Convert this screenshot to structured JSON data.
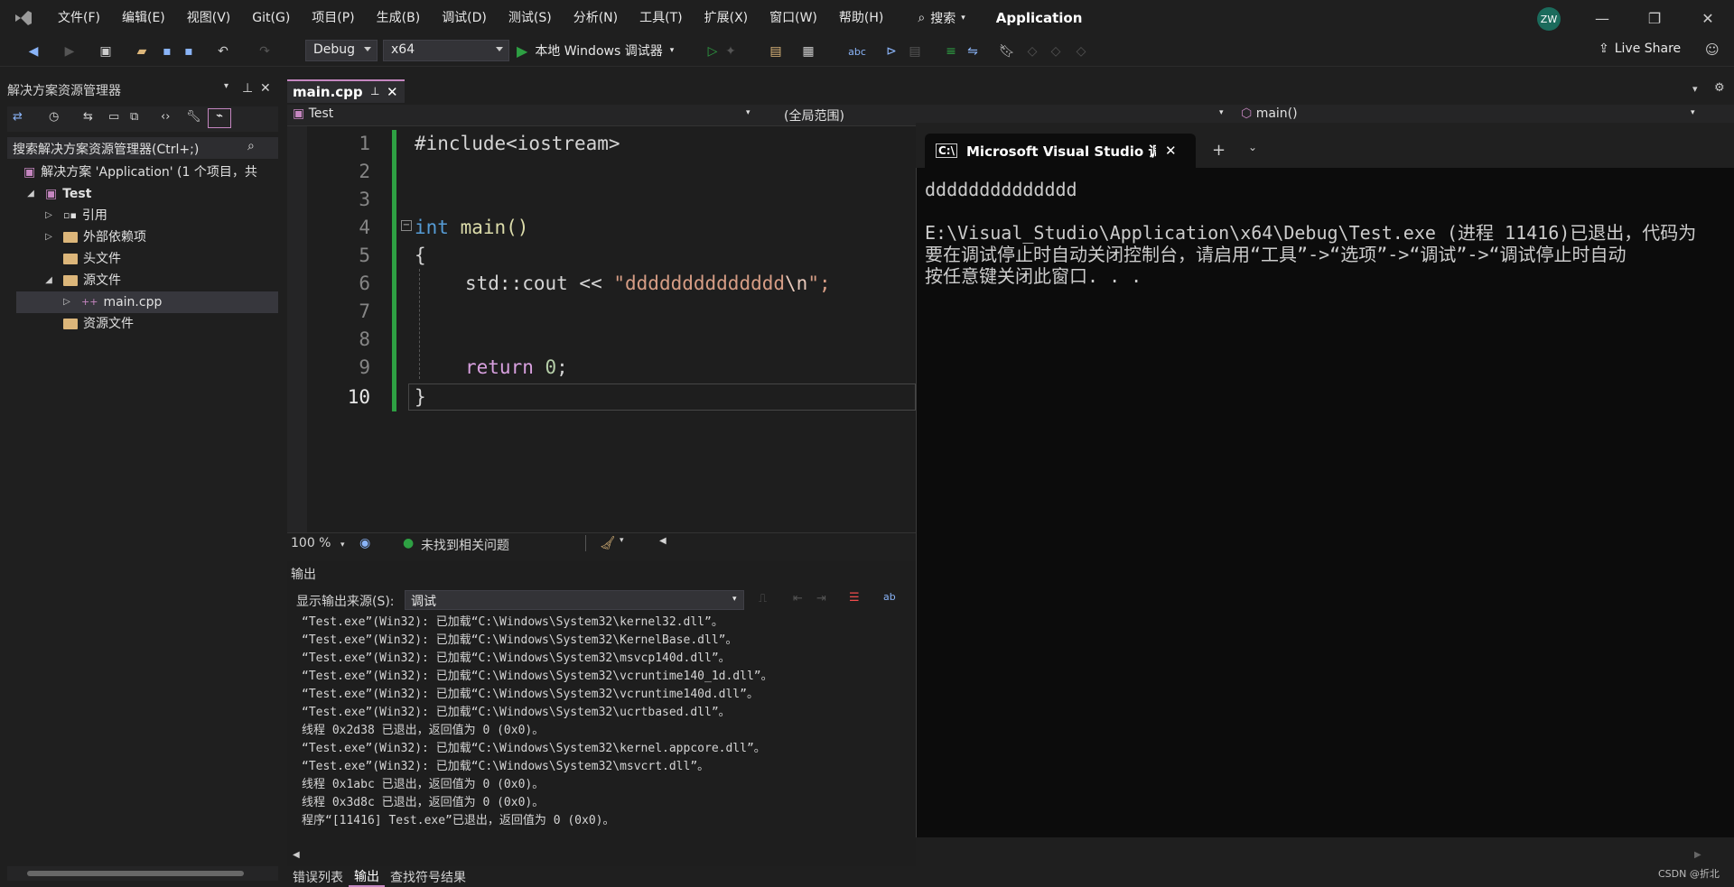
{
  "menubar": {
    "items": [
      "文件(F)",
      "编辑(E)",
      "视图(V)",
      "Git(G)",
      "项目(P)",
      "生成(B)",
      "调试(D)",
      "测试(S)",
      "分析(N)",
      "工具(T)",
      "扩展(X)",
      "窗口(W)",
      "帮助(H)"
    ],
    "search_label": "搜索",
    "app_title": "Application",
    "avatar_initials": "ZW"
  },
  "toolbar": {
    "configuration": "Debug",
    "platform": "x64",
    "debugger_label": "本地 Windows 调试器",
    "live_share": "Live Share"
  },
  "solution_explorer": {
    "title": "解决方案资源管理器",
    "search_placeholder": "搜索解决方案资源管理器(Ctrl+;)",
    "tree": [
      {
        "label": "解决方案 'Application' (1 个项目，共",
        "level": 0,
        "caret": ""
      },
      {
        "label": "Test",
        "level": 1,
        "caret": "◢",
        "bold": true
      },
      {
        "label": "引用",
        "level": 2,
        "caret": "▷"
      },
      {
        "label": "外部依赖项",
        "level": 2,
        "caret": "▷"
      },
      {
        "label": "头文件",
        "level": 2,
        "caret": ""
      },
      {
        "label": "源文件",
        "level": 2,
        "caret": "◢"
      },
      {
        "label": "main.cpp",
        "level": 3,
        "caret": "▷",
        "selected": true
      },
      {
        "label": "资源文件",
        "level": 2,
        "caret": ""
      }
    ]
  },
  "editor": {
    "tab_label": "main.cpp",
    "nav_project": "Test",
    "nav_scope": "(全局范围)",
    "nav_member": "main()",
    "line_numbers": [
      "1",
      "2",
      "3",
      "4",
      "5",
      "6",
      "7",
      "8",
      "9",
      "10"
    ],
    "current_line": "10",
    "code": {
      "l1": "#include<iostream>",
      "l4_kw": "int",
      "l4_rest": " main()",
      "l5": "{",
      "l6_pre": "std::cout << ",
      "l6_str": "\"dddddddddddddd",
      "l6_esc": "\\n",
      "l6_end": "\";",
      "l9_kw": "return",
      "l9_num": "0",
      "l9_end": ";",
      "l10": "}"
    },
    "zoom": "100 %",
    "issues": "未找到相关问题"
  },
  "output": {
    "title": "输出",
    "source_label": "显示输出来源(S):",
    "source_value": "调试",
    "lines": [
      "“Test.exe”(Win32): 已加载“C:\\Windows\\System32\\kernel32.dll”。",
      "“Test.exe”(Win32): 已加载“C:\\Windows\\System32\\KernelBase.dll”。",
      "“Test.exe”(Win32): 已加载“C:\\Windows\\System32\\msvcp140d.dll”。",
      "“Test.exe”(Win32): 已加载“C:\\Windows\\System32\\vcruntime140_1d.dll”。",
      "“Test.exe”(Win32): 已加载“C:\\Windows\\System32\\vcruntime140d.dll”。",
      "“Test.exe”(Win32): 已加载“C:\\Windows\\System32\\ucrtbased.dll”。",
      "线程 0x2d38 已退出，返回值为 0 (0x0)。",
      "“Test.exe”(Win32): 已加载“C:\\Windows\\System32\\kernel.appcore.dll”。",
      "“Test.exe”(Win32): 已加载“C:\\Windows\\System32\\msvcrt.dll”。",
      "线程 0x1abc 已退出，返回值为 0 (0x0)。",
      "线程 0x3d8c 已退出，返回值为 0 (0x0)。",
      "程序“[11416] Test.exe”已退出，返回值为 0 (0x0)。"
    ]
  },
  "bottom_tabs": [
    "错误列表",
    "输出",
    "查找符号结果"
  ],
  "console": {
    "tab_title": "Microsoft Visual Studio 调试控",
    "lines": [
      "dddddddddddddd",
      "",
      "E:\\Visual_Studio\\Application\\x64\\Debug\\Test.exe (进程 11416)已退出，代码为",
      "要在调试停止时自动关闭控制台，请启用“工具”->“选项”->“调试”->“调试停止时自动",
      "按任意键关闭此窗口. . ."
    ]
  },
  "watermark": "CSDN @折北"
}
